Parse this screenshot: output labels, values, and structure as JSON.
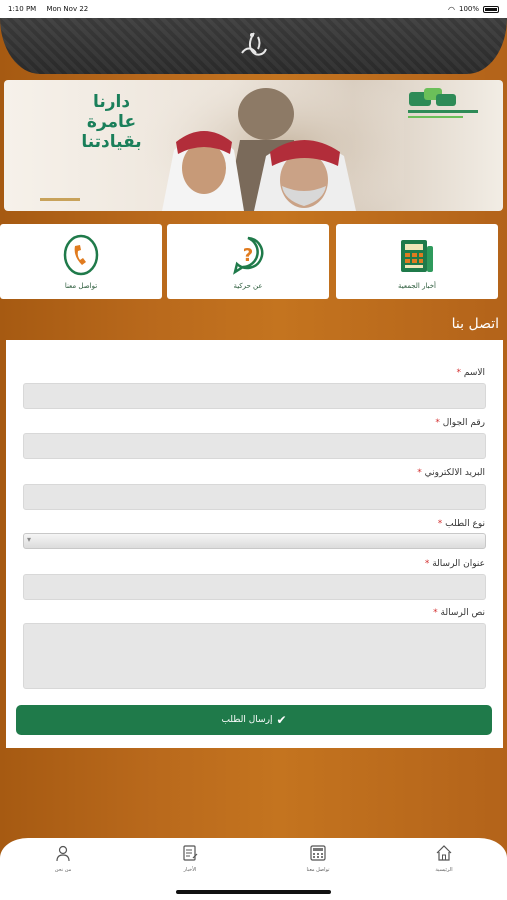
{
  "status_bar": {
    "time": "1:10 PM",
    "date": "Mon Nov 22",
    "battery": "100%"
  },
  "banner": {
    "slogan_line1": "دارنا",
    "slogan_line2": "عامرة",
    "slogan_line3": "بقيادتنا",
    "accent_color": "#1a7f5a"
  },
  "tiles": [
    {
      "label": "تواصل معنا",
      "icon": "phone-icon"
    },
    {
      "label": "عن حركية",
      "icon": "question-icon"
    },
    {
      "label": "أخبار الجمعية",
      "icon": "newspaper-icon"
    }
  ],
  "page_title": "اتصل بنا",
  "form": {
    "name_label": "الاسم",
    "mobile_label": "رقم الجوال",
    "email_label": "البريد الالكتروني",
    "request_type_label": "نوع الطلب",
    "subject_label": "عنوان الرسالة",
    "message_label": "نص الرسالة",
    "required_mark": "*",
    "submit_label": "إرسال الطلب",
    "submit_color": "#1f7a4a"
  },
  "bottom_nav": {
    "home": "الرئيسية",
    "contact": "تواصل معنا",
    "news": "الأخبار",
    "about": "من نحن"
  }
}
